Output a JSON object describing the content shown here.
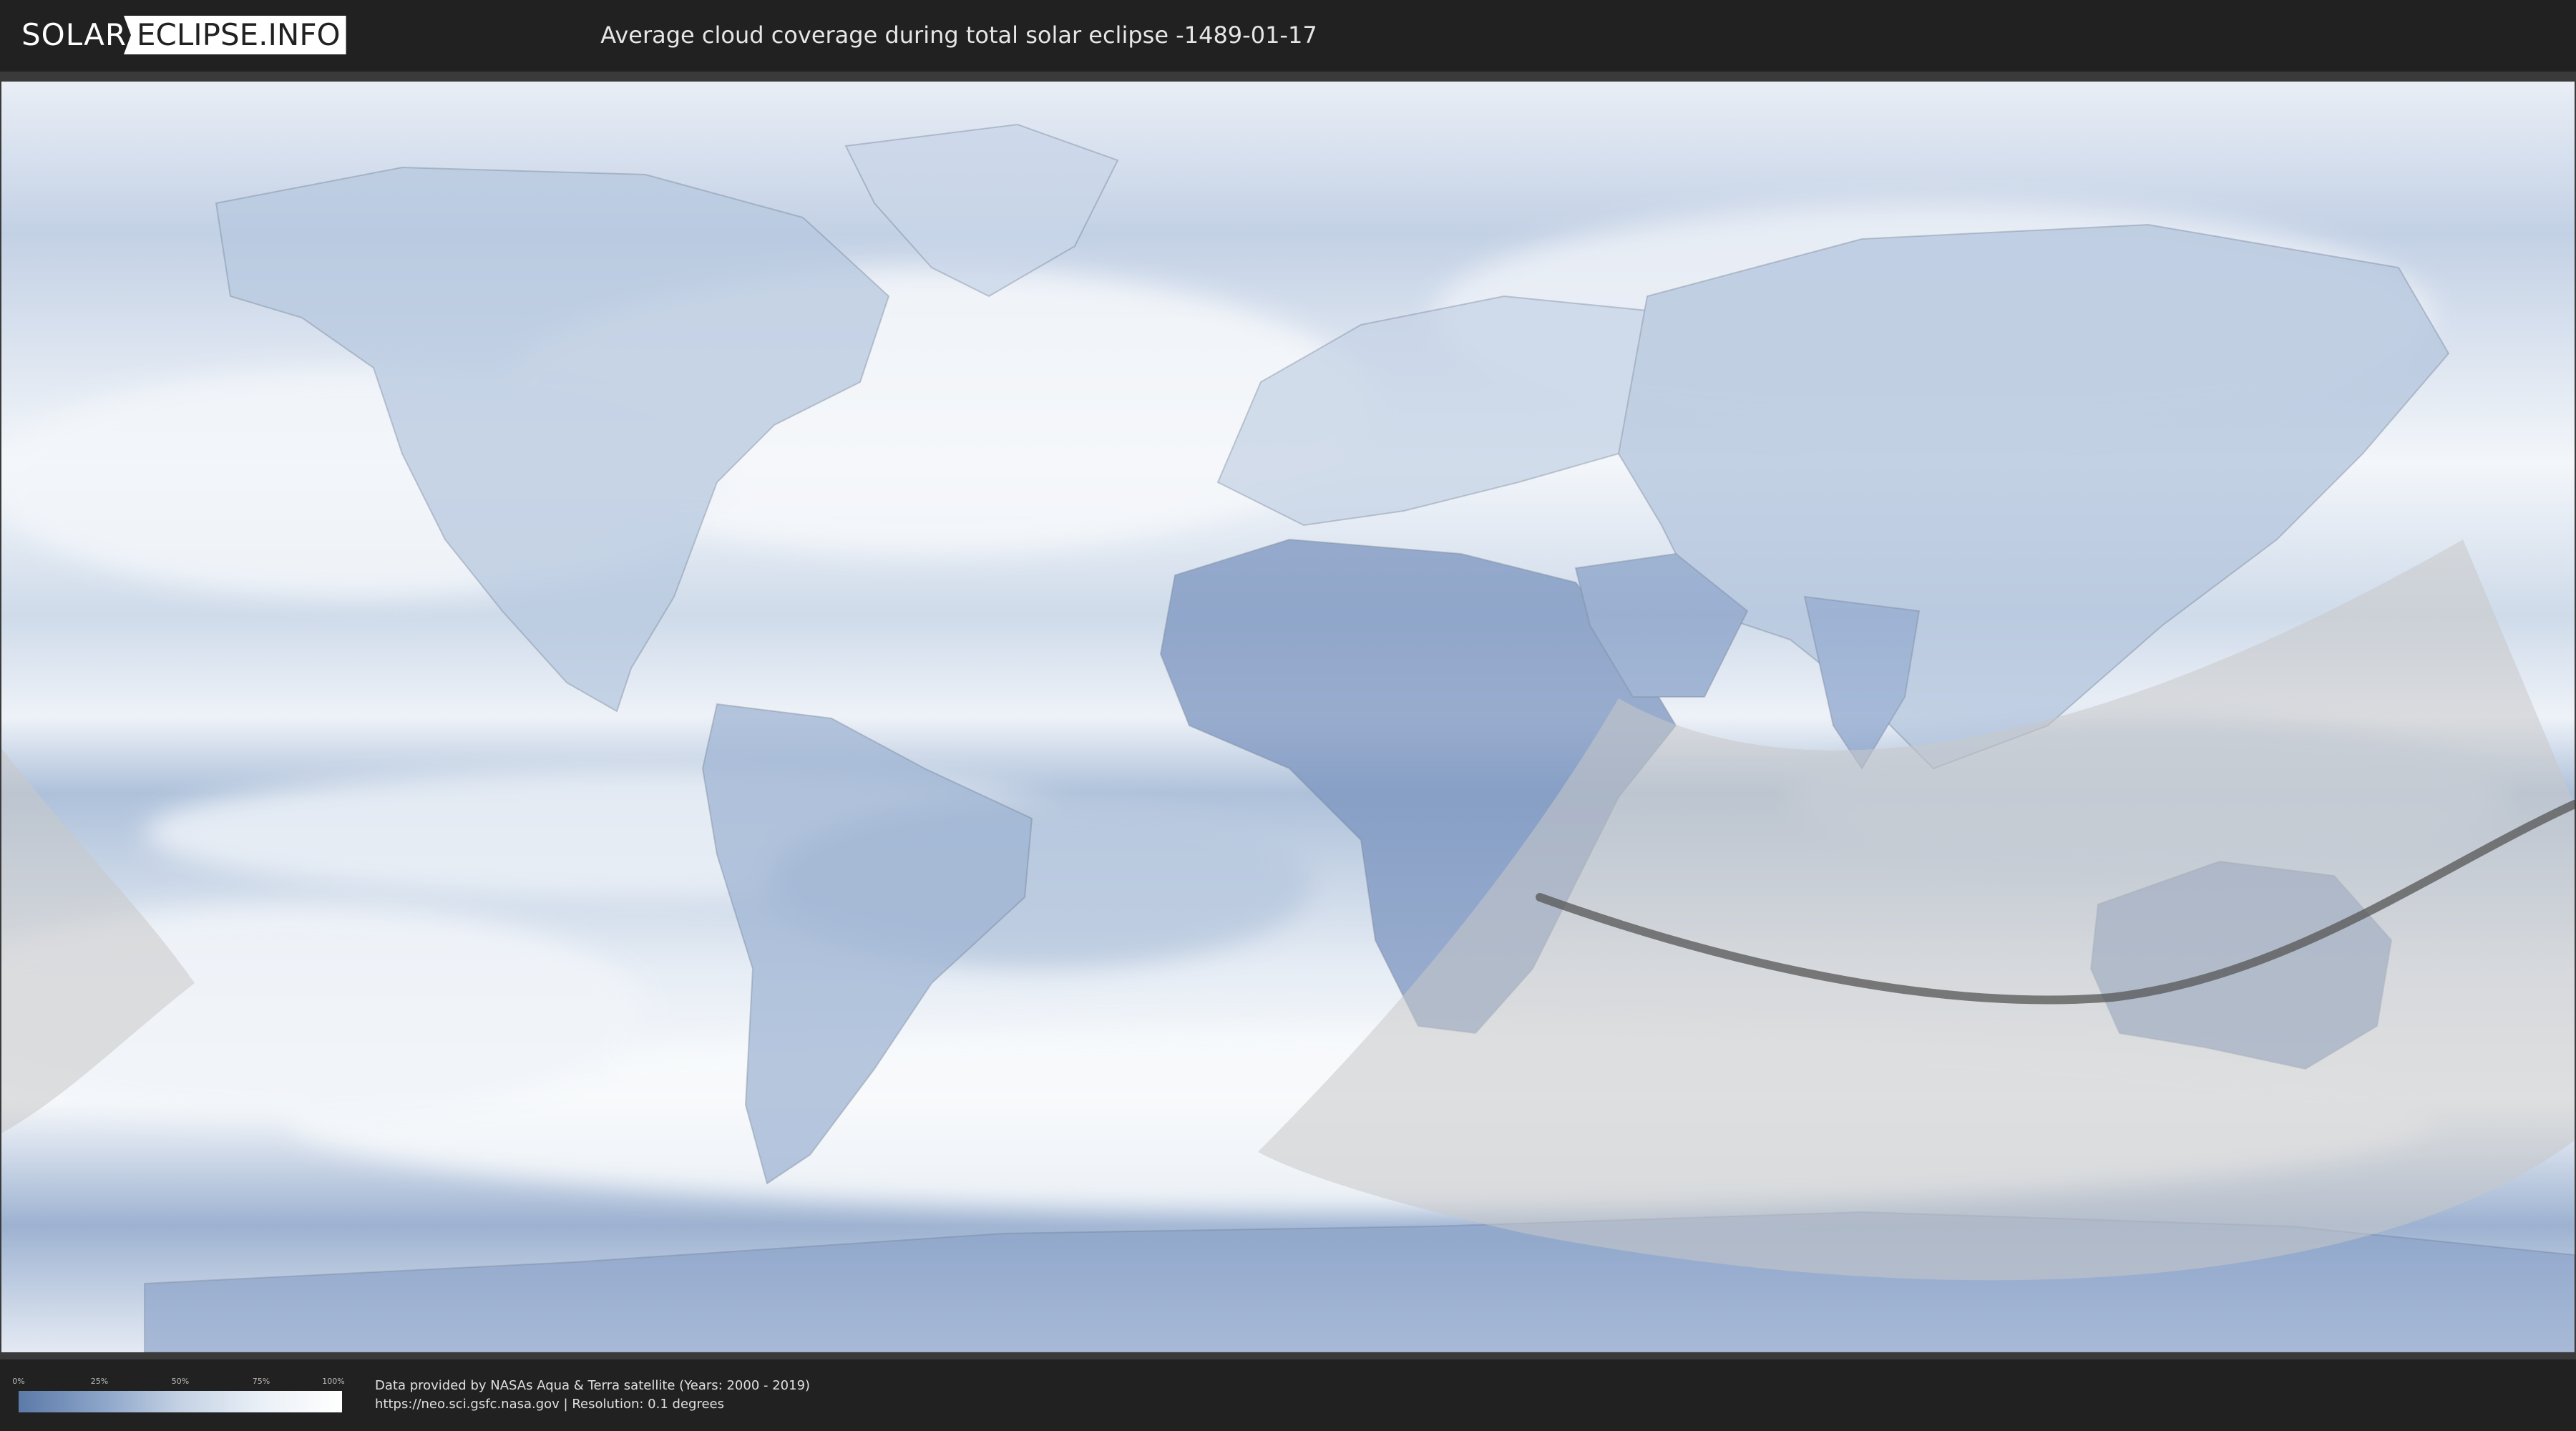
{
  "header": {
    "logo_left": "SOLAR",
    "logo_right": "ECLIPSE.INFO",
    "title": "Average cloud coverage during total solar eclipse -1489-01-17"
  },
  "legend": {
    "ticks": [
      "0%",
      "25%",
      "50%",
      "75%",
      "100%"
    ],
    "colors": [
      "#5c7aa8",
      "#8aa3c8",
      "#c4d2e4",
      "#eaf0f7",
      "#ffffff"
    ]
  },
  "footer": {
    "line1": "Data provided by NASAs Aqua & Terra satellite (Years: 2000 - 2019)",
    "line2": "https://neo.sci.gsfc.nasa.gov | Resolution: 0.1 degrees"
  },
  "map": {
    "ocean_color": "#9fb6d4",
    "cloud_color": "#f4f7fb",
    "land_color": "#7f99c2",
    "shadow_color": "#c8c8c8",
    "path_color": "#555555"
  }
}
